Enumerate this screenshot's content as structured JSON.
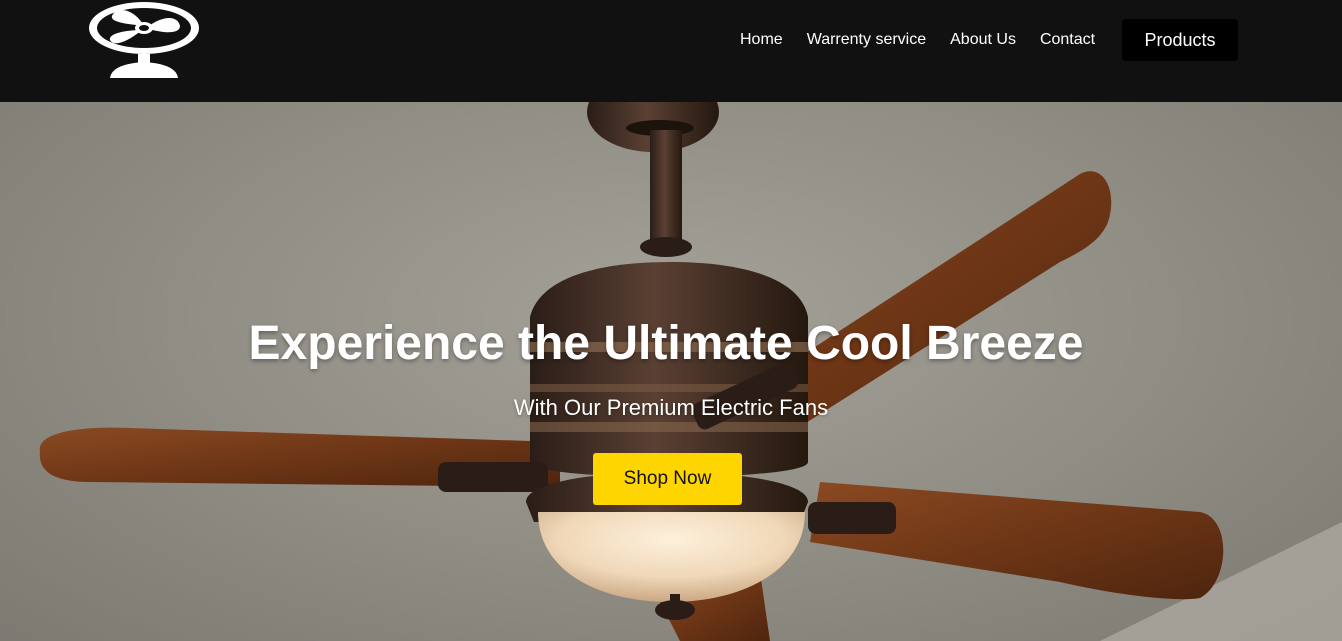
{
  "header": {
    "logo_icon": "fan-logo-icon",
    "nav": [
      {
        "label": "Home"
      },
      {
        "label": "Warrenty service"
      },
      {
        "label": "About Us"
      },
      {
        "label": "Contact"
      }
    ],
    "products_label": "Products"
  },
  "hero": {
    "title": "Experience the Ultimate Cool Breeze",
    "subtitle": "With Our Premium Electric Fans",
    "cta_label": "Shop Now",
    "cta_color": "#ffd500",
    "background_image": "ceiling-fan-photo"
  },
  "colors": {
    "nav_bg": "#111111",
    "text": "#ffffff",
    "wood": "#7a3f1c",
    "bronze": "#3b2a22"
  }
}
